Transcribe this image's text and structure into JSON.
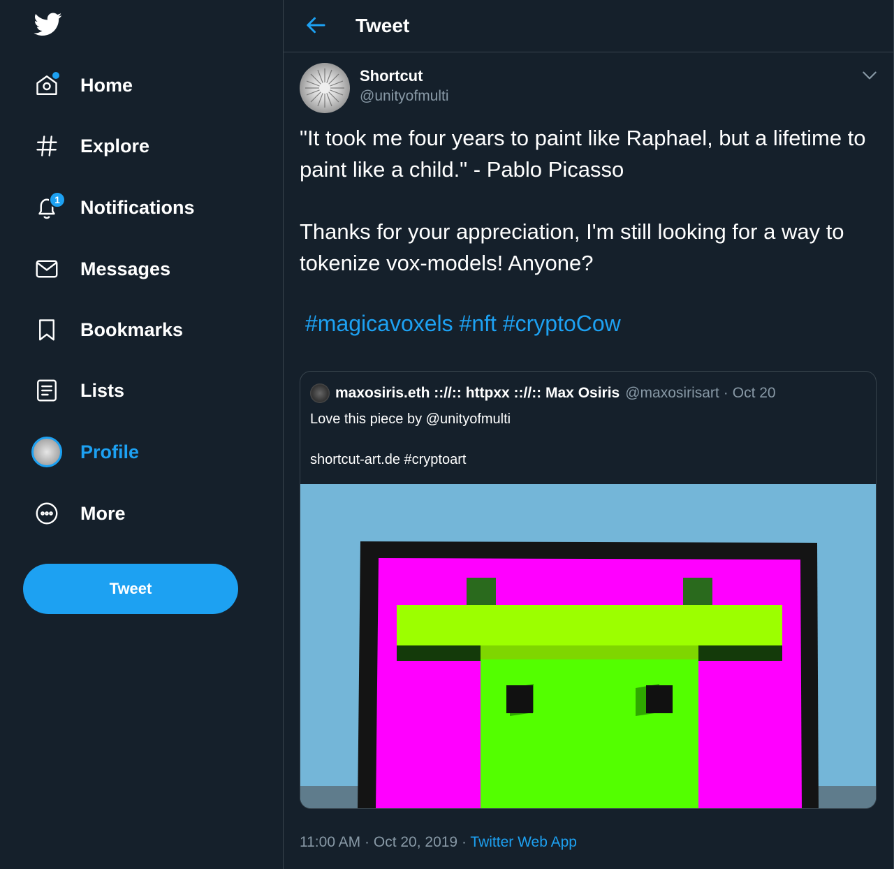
{
  "sidebar": {
    "logo": "twitter-bird-icon",
    "items": [
      {
        "label": "Home",
        "icon": "home-icon"
      },
      {
        "label": "Explore",
        "icon": "hashtag-icon"
      },
      {
        "label": "Notifications",
        "icon": "bell-icon",
        "badge": "1"
      },
      {
        "label": "Messages",
        "icon": "envelope-icon"
      },
      {
        "label": "Bookmarks",
        "icon": "bookmark-icon"
      },
      {
        "label": "Lists",
        "icon": "list-icon"
      },
      {
        "label": "Profile",
        "icon": "avatar",
        "active": true
      },
      {
        "label": "More",
        "icon": "more-circle-icon"
      }
    ],
    "tweet_button": "Tweet"
  },
  "header": {
    "title": "Tweet",
    "back_icon": "arrow-left-icon"
  },
  "tweet": {
    "author_name": "Shortcut",
    "author_handle": "@unityofmulti",
    "text_line1": "\"It took me four years to paint like Raphael, but a lifetime to paint like a child.\" - Pablo Picasso",
    "text_line2": "Thanks for your appreciation, I'm still looking for a way to tokenize vox-models! Anyone?",
    "hashtags": [
      "#magicavoxels",
      "#nft",
      "#cryptoCow"
    ],
    "time": "11:00 AM",
    "date": "Oct 20, 2019",
    "source": "Twitter Web App",
    "separator": "·"
  },
  "quote": {
    "name": "maxosiris.eth ::/​/:: httpxx ::/​/:: Max Osiris",
    "handle": "@maxosirisart",
    "date": "Oct 20",
    "separator": "·",
    "text1": "Love this piece by @unityofmulti",
    "text2": "shortcut-art.de #cryptoart"
  },
  "colors": {
    "background": "#15202b",
    "accent": "#1da1f2",
    "muted": "#8899a6",
    "border": "#38444d"
  }
}
